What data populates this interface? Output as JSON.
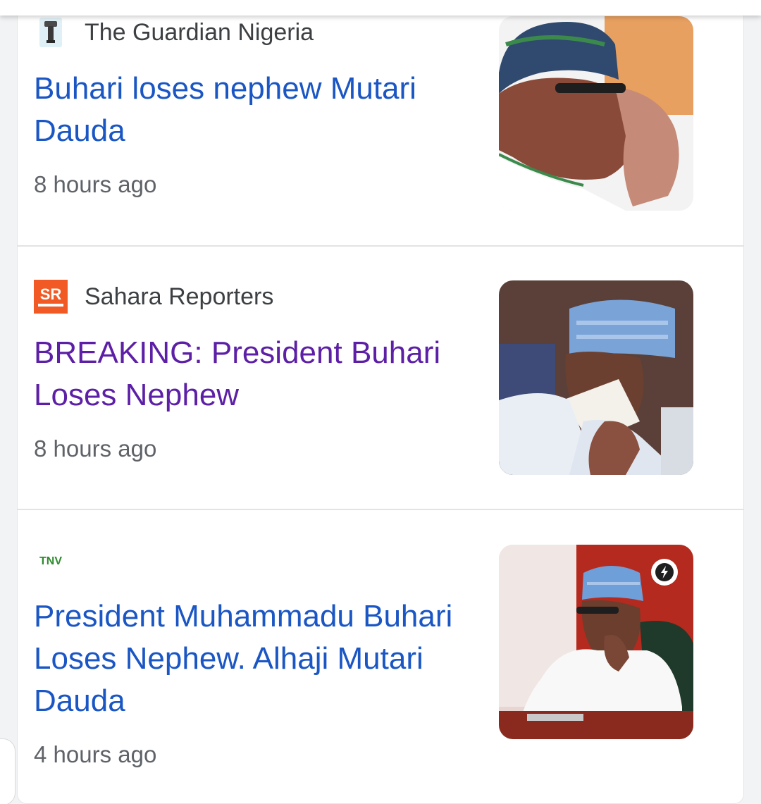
{
  "articles": [
    {
      "source": "The Guardian Nigeria",
      "source_logo": "guardian-torch-icon",
      "headline": "Buhari loses nephew Mutari Dauda",
      "time": "8 hours ago",
      "visited": false,
      "amp": false
    },
    {
      "source": "Sahara Reporters",
      "source_logo": "sahara-reporters-logo",
      "logo_text": "SR",
      "headline": "BREAKING: President Buhari Loses Nephew",
      "time": "8 hours ago",
      "visited": true,
      "amp": false
    },
    {
      "source": "",
      "source_logo": "tnv-logo",
      "logo_text": "TNV",
      "headline": "President Muhammadu Buhari Loses Nephew. Alhaji Mutari Dauda",
      "time": "4 hours ago",
      "visited": false,
      "amp": true
    }
  ],
  "colors": {
    "link": "#1a56c4",
    "visited_link": "#5c1fa6",
    "secondary_text": "#5f6368",
    "sahara_orange": "#f15a24",
    "tnv_green": "#2e8b2e"
  },
  "icons": {
    "amp_badge": "lightning-bolt-icon"
  }
}
